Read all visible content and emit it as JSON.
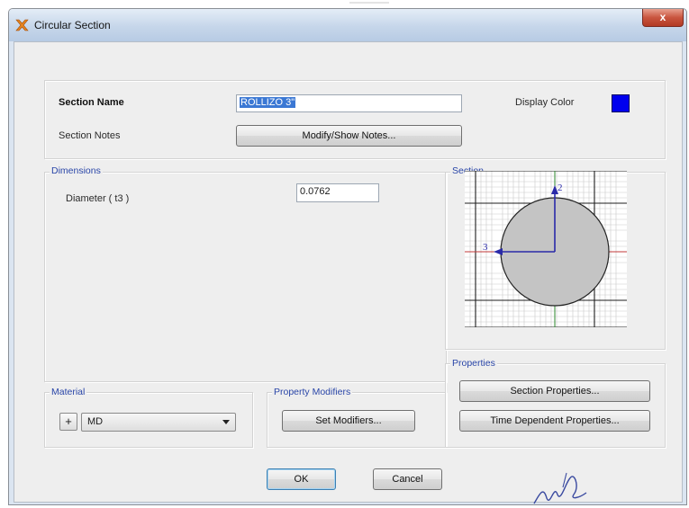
{
  "window": {
    "title": "Circular Section",
    "close_glyph": "x"
  },
  "section": {
    "name_label": "Section Name",
    "name_value": "ROLLIZO 3\"",
    "notes_label": "Section Notes",
    "notes_button": "Modify/Show Notes...",
    "display_color_label": "Display Color",
    "display_color": "#0000ee"
  },
  "dimensions": {
    "group_label": "Dimensions",
    "diameter_label": "Diameter  ( t3 )",
    "diameter_value": "0.0762"
  },
  "section_view": {
    "group_label": "Section",
    "axis2_label": "2",
    "axis3_label": "3"
  },
  "material": {
    "group_label": "Material",
    "plus_label": "+",
    "selected": "MD"
  },
  "modifiers": {
    "group_label": "Property Modifiers",
    "button": "Set Modifiers..."
  },
  "properties": {
    "group_label": "Properties",
    "section_button": "Section Properties...",
    "time_button": "Time Dependent Properties..."
  },
  "footer": {
    "ok": "OK",
    "cancel": "Cancel"
  },
  "icons": {
    "title": "etabs-x-icon",
    "section_close": "close-icon"
  }
}
